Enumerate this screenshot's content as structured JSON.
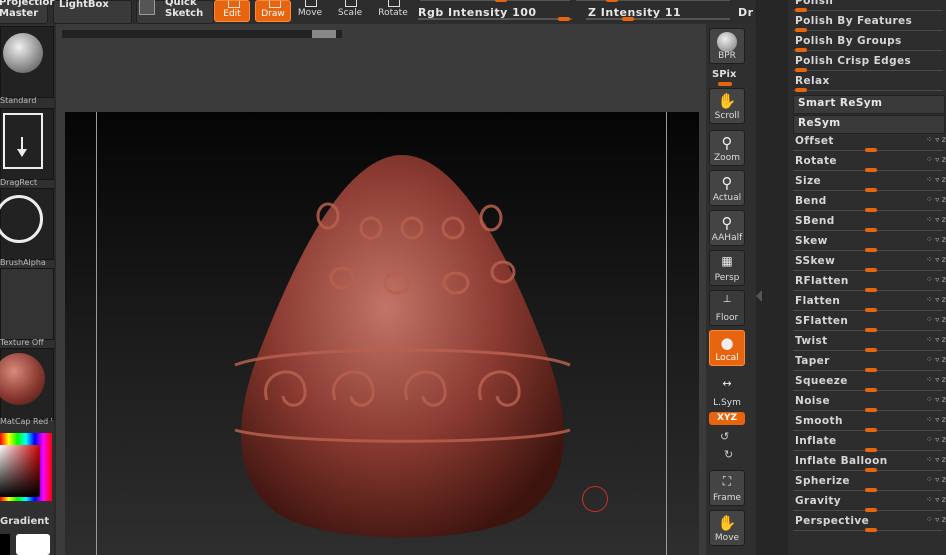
{
  "topbar": {
    "projection_master": "Projection\nMaster",
    "lightbox": "LightBox",
    "quick_sketch": "Quick\nSketch",
    "tools": [
      {
        "label": "Edit",
        "active": true
      },
      {
        "label": "Draw",
        "active": true
      },
      {
        "label": "Move",
        "active": false
      },
      {
        "label": "Scale",
        "active": false
      },
      {
        "label": "Rotate",
        "active": false
      }
    ],
    "rgb_intensity": "Rgb Intensity 100",
    "z_intensity": "Z Intensity 11",
    "draw_size_abbrev": "Dr"
  },
  "left_palette": {
    "brush_label": "Standard",
    "stroke_label": "DragRect",
    "alpha_label": "BrushAlpha",
    "texture_label": "Texture Off",
    "material_label": "MatCap Red Wax",
    "gradient_label": "Gradient"
  },
  "shelf": {
    "bpr": "BPR",
    "spix": "SPix",
    "scroll": "Scroll",
    "zoom": "Zoom",
    "actual": "Actual",
    "aahalf": "AAHalf",
    "persp": "Persp",
    "floor": "Floor",
    "local": "Local",
    "lsym": "L.Sym",
    "xyz": "XYZ",
    "frame": "Frame",
    "move": "Move"
  },
  "deformation": {
    "top_items": [
      "Polish",
      "Polish By Features",
      "Polish By Groups",
      "Polish Crisp Edges",
      "Relax"
    ],
    "smart_resym": "Smart ReSym",
    "resym": "ReSym",
    "sliders": [
      "Offset",
      "Rotate",
      "Size",
      "Bend",
      "SBend",
      "Skew",
      "SSkew",
      "RFlatten",
      "Flatten",
      "SFlatten",
      "Twist",
      "Taper",
      "Squeeze",
      "Noise",
      "Smooth",
      "Inflate",
      "Inflate Balloon",
      "Spherize",
      "Gravity",
      "Perspective"
    ]
  },
  "colors": {
    "accent": "#e8650f",
    "model_base": "#8a3a30",
    "model_highlight": "#c27468"
  }
}
